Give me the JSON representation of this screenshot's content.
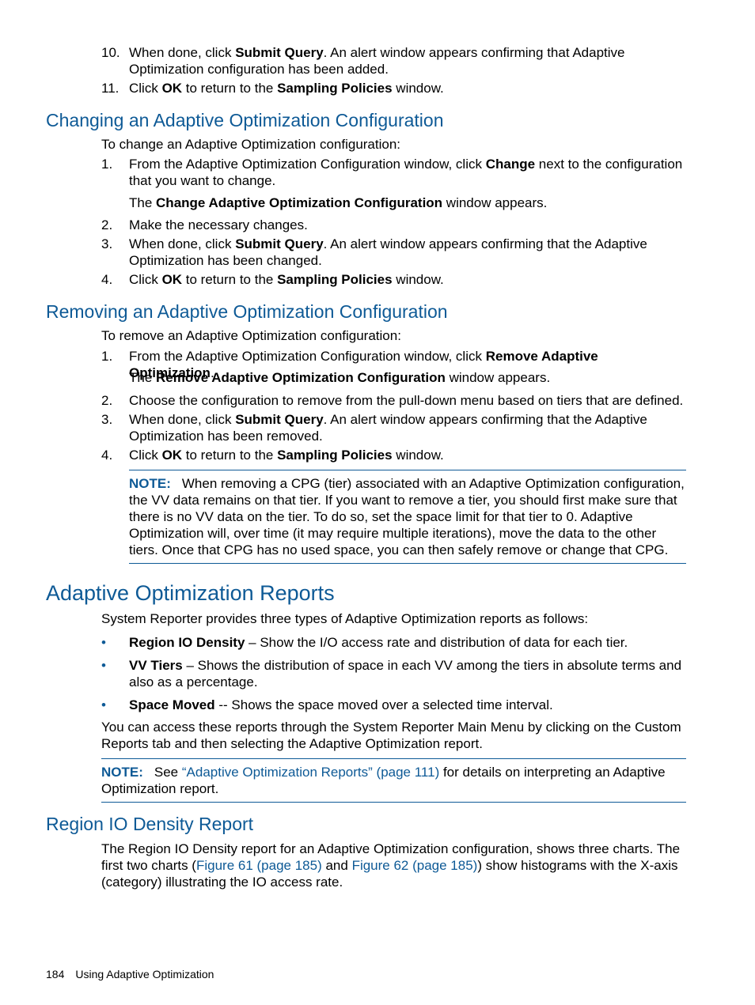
{
  "top_steps": [
    {
      "num": "10.",
      "pre": "When done, click ",
      "bold": "Submit Query",
      "post": ". An alert window appears confirming that Adaptive Optimization configuration has been added."
    },
    {
      "num": "11.",
      "pre": "Click ",
      "bold": "OK",
      "mid": " to return to the ",
      "bold2": "Sampling Policies",
      "post": " window."
    }
  ],
  "changing": {
    "heading": "Changing an Adaptive Optimization Configuration",
    "intro": "To change an Adaptive Optimization configuration:",
    "step1": {
      "num": "1.",
      "pre": "From the Adaptive Optimization Configuration window, click ",
      "bold": "Change",
      "post": " next to the configuration that you want to change."
    },
    "step1_sub": {
      "pre": "The ",
      "bold": "Change Adaptive Optimization Configuration",
      "post": " window appears."
    },
    "step2": {
      "num": "2.",
      "text": "Make the necessary changes."
    },
    "step3": {
      "num": "3.",
      "pre": "When done, click ",
      "bold": "Submit Query",
      "post": ". An alert window appears confirming that the Adaptive Optimization has been changed."
    },
    "step4": {
      "num": "4.",
      "pre": "Click ",
      "bold": "OK",
      "mid": " to return to the ",
      "bold2": "Sampling Policies",
      "post": " window."
    }
  },
  "removing": {
    "heading": "Removing an Adaptive Optimization Configuration",
    "intro": "To remove an Adaptive Optimization configuration:",
    "step1": {
      "num": "1.",
      "pre": "From the Adaptive Optimization Configuration window, click ",
      "bold": "Remove Adaptive Optimization",
      "post": "."
    },
    "step1_sub": {
      "pre": "The ",
      "bold": "Remove Adaptive Optimization Configuration",
      "post": " window appears."
    },
    "step2": {
      "num": "2.",
      "text": "Choose the configuration to remove from the pull-down menu based on tiers that are defined."
    },
    "step3": {
      "num": "3.",
      "pre": "When done, click ",
      "bold": "Submit Query",
      "post": ". An alert window appears confirming that the Adaptive Optimization has been removed."
    },
    "step4": {
      "num": "4.",
      "pre": "Click ",
      "bold": "OK",
      "mid": " to return to the ",
      "bold2": "Sampling Policies",
      "post": " window."
    },
    "note": {
      "label": "NOTE:",
      "text": "When removing a CPG (tier) associated with an Adaptive Optimization configuration, the VV data remains on that tier. If you want to remove a tier, you should first make sure that there is no VV data on the tier. To do so, set the space limit for that tier to 0. Adaptive Optimization will, over time (it may require multiple iterations), move the data to the other tiers. Once that CPG has no used space, you can then safely remove or change that CPG."
    }
  },
  "reports": {
    "heading": "Adaptive Optimization Reports",
    "intro": "System Reporter provides three types of Adaptive Optimization reports as follows:",
    "bullets": [
      {
        "bold": "Region IO Density",
        "text": " – Show the I/O access rate and distribution of data for each tier."
      },
      {
        "bold": "VV Tiers",
        "text": " – Shows the distribution of space in each VV among the tiers in absolute terms and also as a percentage."
      },
      {
        "bold": "Space Moved",
        "text": " -- Shows the space moved over a selected time interval."
      }
    ],
    "access": "You can access these reports through the System Reporter Main Menu by clicking on the Custom Reports tab and then selecting the Adaptive Optimization report.",
    "note": {
      "label": "NOTE:",
      "pre": "See ",
      "link": "“Adaptive Optimization Reports” (page 111)",
      "post": " for details on interpreting an Adaptive Optimization report."
    }
  },
  "region": {
    "heading": "Region IO Density Report",
    "pre": "The Region IO Density report for an Adaptive Optimization configuration, shows three charts. The first two charts (",
    "link1": "Figure 61 (page 185)",
    "mid": " and ",
    "link2": "Figure 62 (page 185)",
    "post": ") show histograms with the X-axis (category) illustrating the IO access rate."
  },
  "footer": {
    "page": "184",
    "title": "Using Adaptive Optimization"
  }
}
